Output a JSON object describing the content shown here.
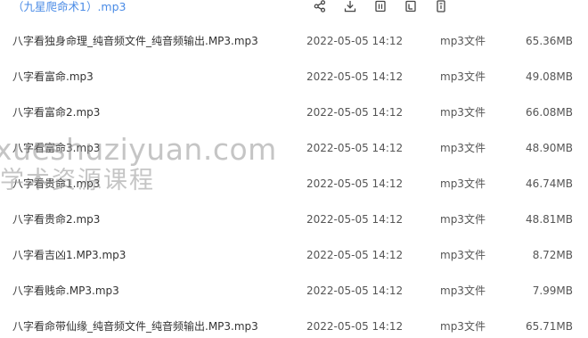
{
  "header": {
    "selected_file": "（九星爬命术1）.mp3",
    "toolbar": [
      "share-icon",
      "download-icon",
      "delete-icon",
      "rename-icon",
      "more-icon"
    ]
  },
  "files": [
    {
      "name": "八字看独身命理_纯音频文件_纯音频输出.MP3.mp3",
      "date": "2022-05-05 14:12",
      "type": "mp3文件",
      "size": "65.36MB"
    },
    {
      "name": "八字看富命.mp3",
      "date": "2022-05-05 14:12",
      "type": "mp3文件",
      "size": "49.08MB"
    },
    {
      "name": "八字看富命2.mp3",
      "date": "2022-05-05 14:12",
      "type": "mp3文件",
      "size": "66.08MB"
    },
    {
      "name": "八字看富命3.mp3",
      "date": "2022-05-05 14:12",
      "type": "mp3文件",
      "size": "48.90MB"
    },
    {
      "name": "八字看贵命1.mp3",
      "date": "2022-05-05 14:12",
      "type": "mp3文件",
      "size": "46.74MB"
    },
    {
      "name": "八字看贵命2.mp3",
      "date": "2022-05-05 14:12",
      "type": "mp3文件",
      "size": "48.81MB"
    },
    {
      "name": "八字看吉凶1.MP3.mp3",
      "date": "2022-05-05 14:12",
      "type": "mp3文件",
      "size": "8.72MB"
    },
    {
      "name": "八字看贱命.MP3.mp3",
      "date": "2022-05-05 14:12",
      "type": "mp3文件",
      "size": "7.99MB"
    },
    {
      "name": "八字看命带仙缘_纯音频文件_纯音频输出.MP3.mp3",
      "date": "2022-05-05 14:12",
      "type": "mp3文件",
      "size": "65.71MB"
    }
  ],
  "watermark": {
    "url": "xueshuziyuan.com",
    "text": "学术资源课程"
  }
}
